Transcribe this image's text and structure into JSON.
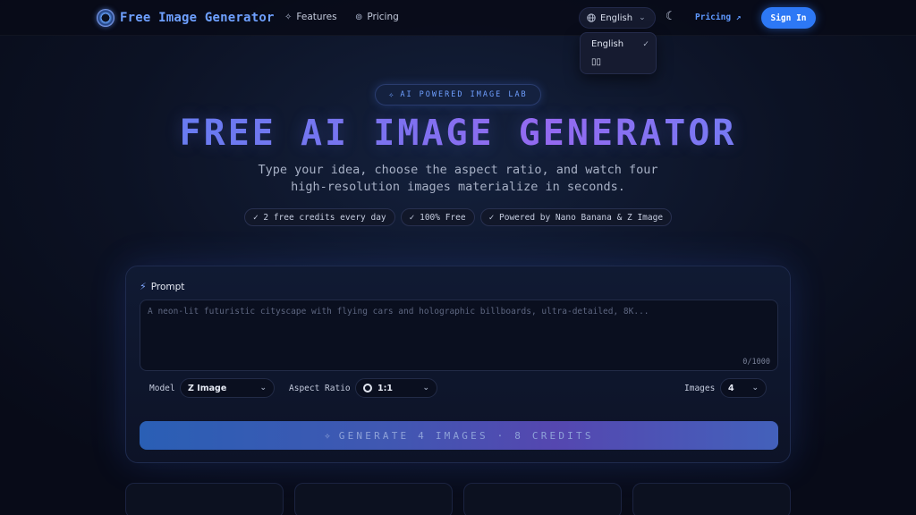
{
  "nav": {
    "logo_text": "Free Image Generator",
    "links": [
      {
        "label": "Features",
        "icon": "sparkles-icon"
      },
      {
        "label": "Pricing",
        "icon": "coin-icon"
      }
    ],
    "language": "English",
    "pricing_link": "Pricing ↗",
    "sign_in": "Sign In"
  },
  "language_menu": {
    "items": [
      {
        "label": "English",
        "selected": true
      },
      {
        "label": "▯▯",
        "selected": false
      }
    ]
  },
  "hero": {
    "badge": "AI POWERED IMAGE LAB",
    "title": "FREE AI IMAGE GENERATOR",
    "subtitle_line1": "Type your idea, choose the aspect ratio, and watch four",
    "subtitle_line2": "high-resolution images materialize in seconds.",
    "chips": [
      "✓ 2 free credits every day",
      "✓ 100% Free",
      "✓ Powered by Nano Banana & Z Image"
    ]
  },
  "generator": {
    "prompt_label": "Prompt",
    "prompt_value": "",
    "prompt_placeholder": "A neon-lit futuristic cityscape with flying cars and holographic billboards, ultra-detailed, 8K...",
    "char_counter": "0/1000",
    "model_label": "Model",
    "model_value": "Z Image",
    "aspect_label": "Aspect Ratio",
    "aspect_value": "1:1",
    "images_label": "Images",
    "images_value": "4",
    "generate_label": "GENERATE 4 IMAGES · 8 CREDITS"
  },
  "colors": {
    "accent": "#2d78f5",
    "logo": "#6ea0ff",
    "background": "#0c1224"
  }
}
